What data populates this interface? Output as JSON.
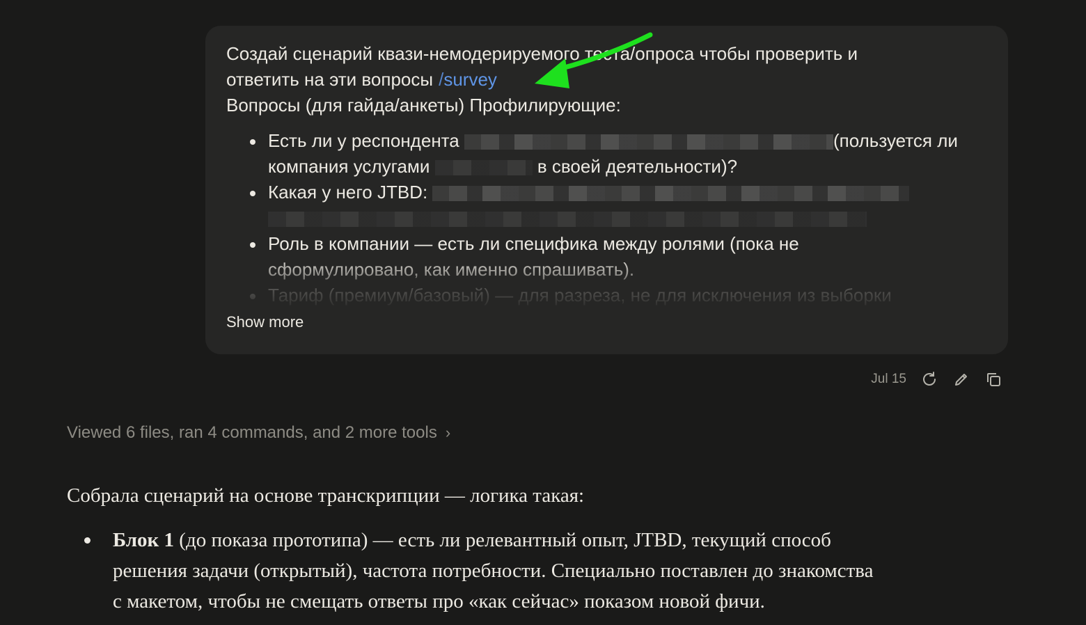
{
  "user_message": {
    "line1": "Создай сценарий квази-немодерируемого теста/опроса чтобы проверить и",
    "line2": "ответить на эти вопросы",
    "survey_slash": "/",
    "survey_tag": "survey",
    "line3": "Вопросы (для гайда/анкеты) Профилирующие:",
    "bullets": {
      "b1_a": "Есть ли у респондента",
      "b1_b": "(пользуется ли",
      "b1_c": "компания услугами",
      "b1_d": "в своей деятельности)?",
      "b2_a": "Какая у него JTBD:",
      "b3_a": "Роль в компании — есть ли специфика между ролями (пока не",
      "b3_b": "сформулировано, как именно спрашивать).",
      "b4_a": "Тариф (премиум/базовый) — для разреза, не для исключения из выборки"
    },
    "show_more": "Show more"
  },
  "meta": {
    "date": "Jul 15",
    "retry_icon": "retry-icon",
    "edit_icon": "pencil-icon",
    "copy_icon": "copy-icon"
  },
  "tools_summary": {
    "text": "Viewed 6 files, ran 4 commands, and 2 more tools",
    "chevron": "›"
  },
  "reply": {
    "intro": "Собрала сценарий на основе транскрипции — логика такая:",
    "block1_title": "Блок 1",
    "block1_line1": " (до показа прототипа) — есть ли релевантный опыт, JTBD, текущий способ",
    "block1_line2": "решения задачи (открытый), частота потребности. Специально поставлен до знакомства",
    "block1_line3": "с макетом, чтобы не смещать ответы про «как сейчас» показом новой фичи."
  },
  "colors": {
    "background": "#1a1a19",
    "bubble": "#262625",
    "survey_accent": "#5f95e6",
    "annotation_arrow": "#1ee01e"
  }
}
